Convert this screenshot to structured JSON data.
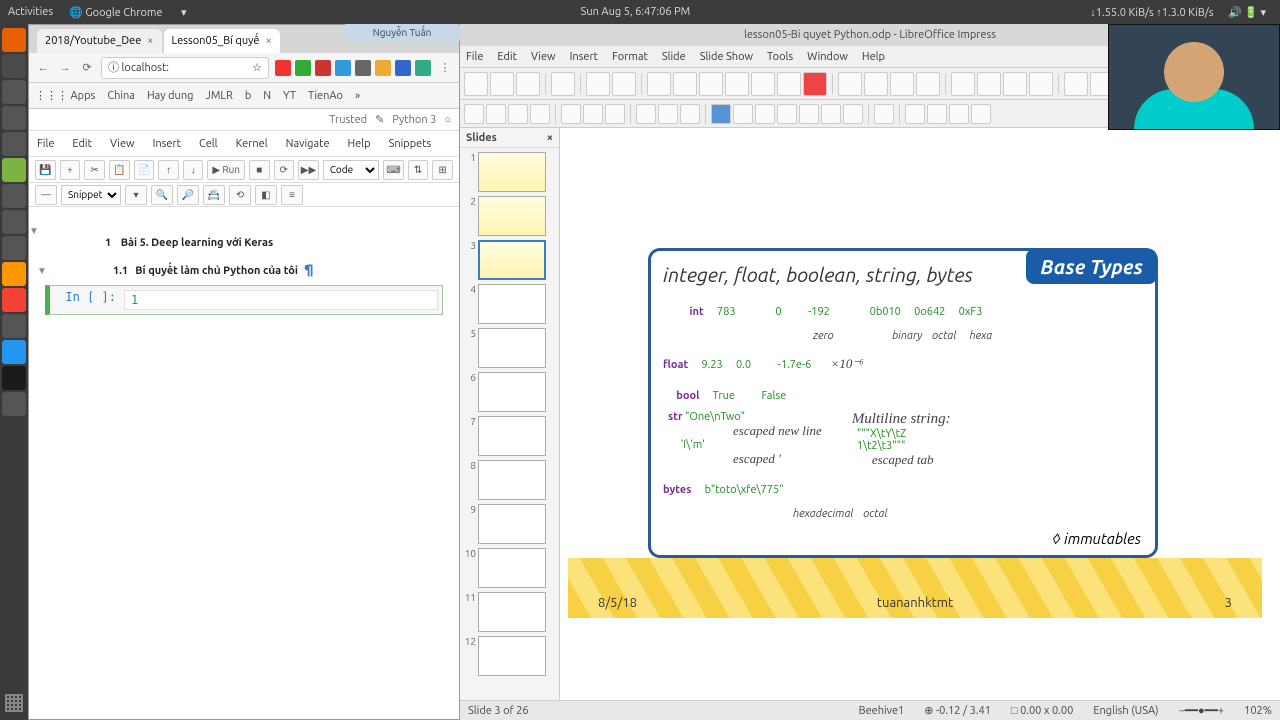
{
  "topbar": {
    "activities": "Activities",
    "app": "Google Chrome",
    "datetime": "Sun Aug 5,  6:47:06 PM",
    "net": "↓1.55.0 KiB/s ↑1.3.0 KiB/s"
  },
  "dock": [
    "firefox",
    "files",
    "term",
    "term",
    "term",
    "vscode",
    "folder",
    "folder",
    "gimp",
    "chrome",
    "libre",
    "apps",
    "skype",
    "obs",
    "doc"
  ],
  "chrome": {
    "tabs": [
      {
        "label": "2018/Youtube_Dee"
      },
      {
        "label": "Lesson05_Bí quyế"
      }
    ],
    "url": "localhost:",
    "bookmarks": [
      "Apps",
      "China",
      "Hay dung",
      "JMLR",
      "b",
      "N",
      "YT",
      "TienAo"
    ]
  },
  "jup": {
    "status": {
      "trusted": "Trusted",
      "kernel": "Python 3"
    },
    "menu": [
      "File",
      "Edit",
      "View",
      "Insert",
      "Cell",
      "Kernel",
      "Navigate",
      "Help",
      "Snippets"
    ],
    "tb": {
      "run": "▶ Run",
      "celltype": "Code",
      "snippets": "Snippets"
    },
    "h1_num": "1",
    "h1": "Bài 5. Deep learning với Keras",
    "h2_num": "1.1",
    "h2": "Bí quyết làm chủ Python của tôi",
    "cell": {
      "prompt": "In [ ]:",
      "code": "1"
    }
  },
  "impress": {
    "title": "lesson05-Bi quyet Python.odp - LibreOffice Impress",
    "user": "Nguyễn Tuấn",
    "menu": [
      "File",
      "Edit",
      "View",
      "Insert",
      "Format",
      "Slide",
      "Slide Show",
      "Tools",
      "Window",
      "Help"
    ],
    "slides_hdr": "Slides",
    "slide_count": 12,
    "selected_slide": 3,
    "status": {
      "slide": "Slide 3 of 26",
      "master": "Beehive1",
      "pos": "⊕ -0.12 / 3.41",
      "size": "□ 0.00 x 0.00",
      "lang": "English (USA)",
      "zoom": "102%"
    }
  },
  "slide": {
    "badge": "Base Types",
    "head": "integer, float, boolean, string, bytes",
    "int": {
      "kw": "int",
      "v1": "783",
      "v2": "0",
      "v3": "-192",
      "v4": "0b010",
      "v5": "0o642",
      "v6": "0xF3"
    },
    "int_ann": {
      "zero": "zero",
      "bin": "binary",
      "oct": "octal",
      "hex": "hexa"
    },
    "float": {
      "kw": "float",
      "v1": "9.23",
      "v2": "0.0",
      "v3": "-1.7e-6",
      "exp": "×10⁻⁶"
    },
    "bool": {
      "kw": "bool",
      "t": "True",
      "f": "False"
    },
    "str": {
      "kw": "str",
      "v1": "\"One\\nTwo\"",
      "ml": "Multiline string:",
      "ml1": "\"\"\"X\\tY\\tZ",
      "ml2": "1\\t2\\t3\"\"\"",
      "esc_nl": "escaped new line",
      "v2": "'I\\'m'",
      "esc_q": "escaped  '",
      "esc_t": "escaped tab"
    },
    "bytes": {
      "kw": "bytes",
      "v": "b\"toto\\xfe\\775\"",
      "hex": "hexadecimal",
      "oct": "octal"
    },
    "immut": "◊ immutables",
    "date": "8/5/18",
    "author": "tuananhktmt",
    "page": "3"
  }
}
